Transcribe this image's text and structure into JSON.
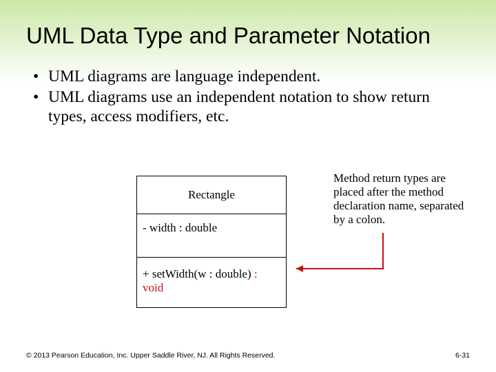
{
  "title": "UML Data Type and Parameter Notation",
  "bullets": [
    "UML diagrams are language independent.",
    "UML diagrams use an independent notation to show return types, access modifiers, etc."
  ],
  "uml": {
    "class_name": "Rectangle",
    "attribute": "- width : double",
    "operation_prefix": "+ setWidth(w : double)",
    "operation_sep": " : ",
    "operation_return": "void"
  },
  "annotation": "Method return types are placed after the method declaration name, separated by a colon.",
  "footer": "© 2013 Pearson Education, Inc. Upper Saddle River, NJ. All Rights Reserved.",
  "page": "6-31"
}
